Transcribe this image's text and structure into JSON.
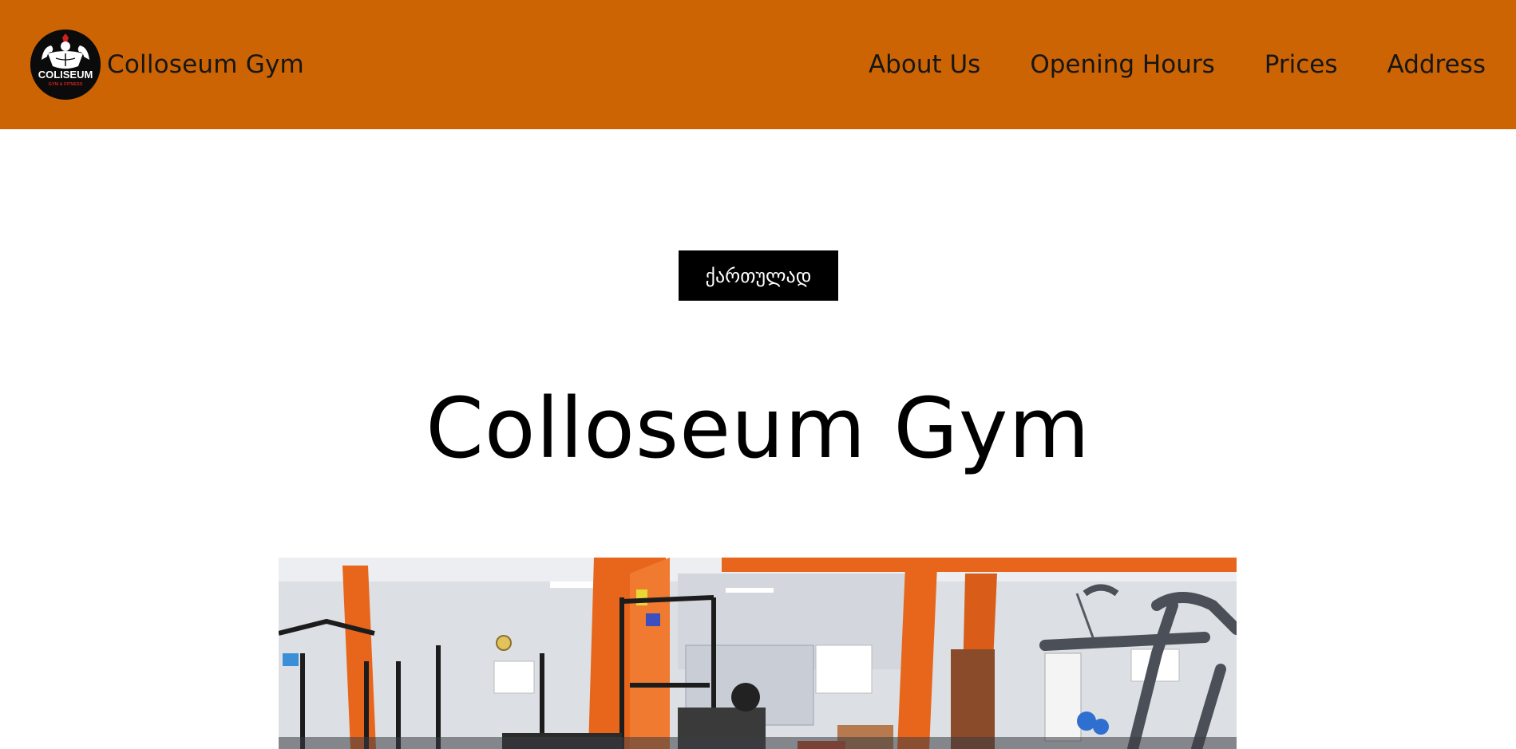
{
  "header": {
    "brand_name": "Colloseum Gym",
    "logo": {
      "icon": "coliseum-logo",
      "main_text": "COLISEUM",
      "sub_text": "GYM & FITNESS"
    },
    "nav": [
      {
        "label": "About Us"
      },
      {
        "label": "Opening Hours"
      },
      {
        "label": "Prices"
      },
      {
        "label": "Address"
      }
    ]
  },
  "main": {
    "language_button": "ქართულად",
    "title": "Colloseum Gym",
    "photo": {
      "icon": "gym-interior-photo"
    }
  },
  "colors": {
    "header_bg": "#cc6404",
    "button_bg": "#000000",
    "accent_orange": "#e8661c"
  }
}
